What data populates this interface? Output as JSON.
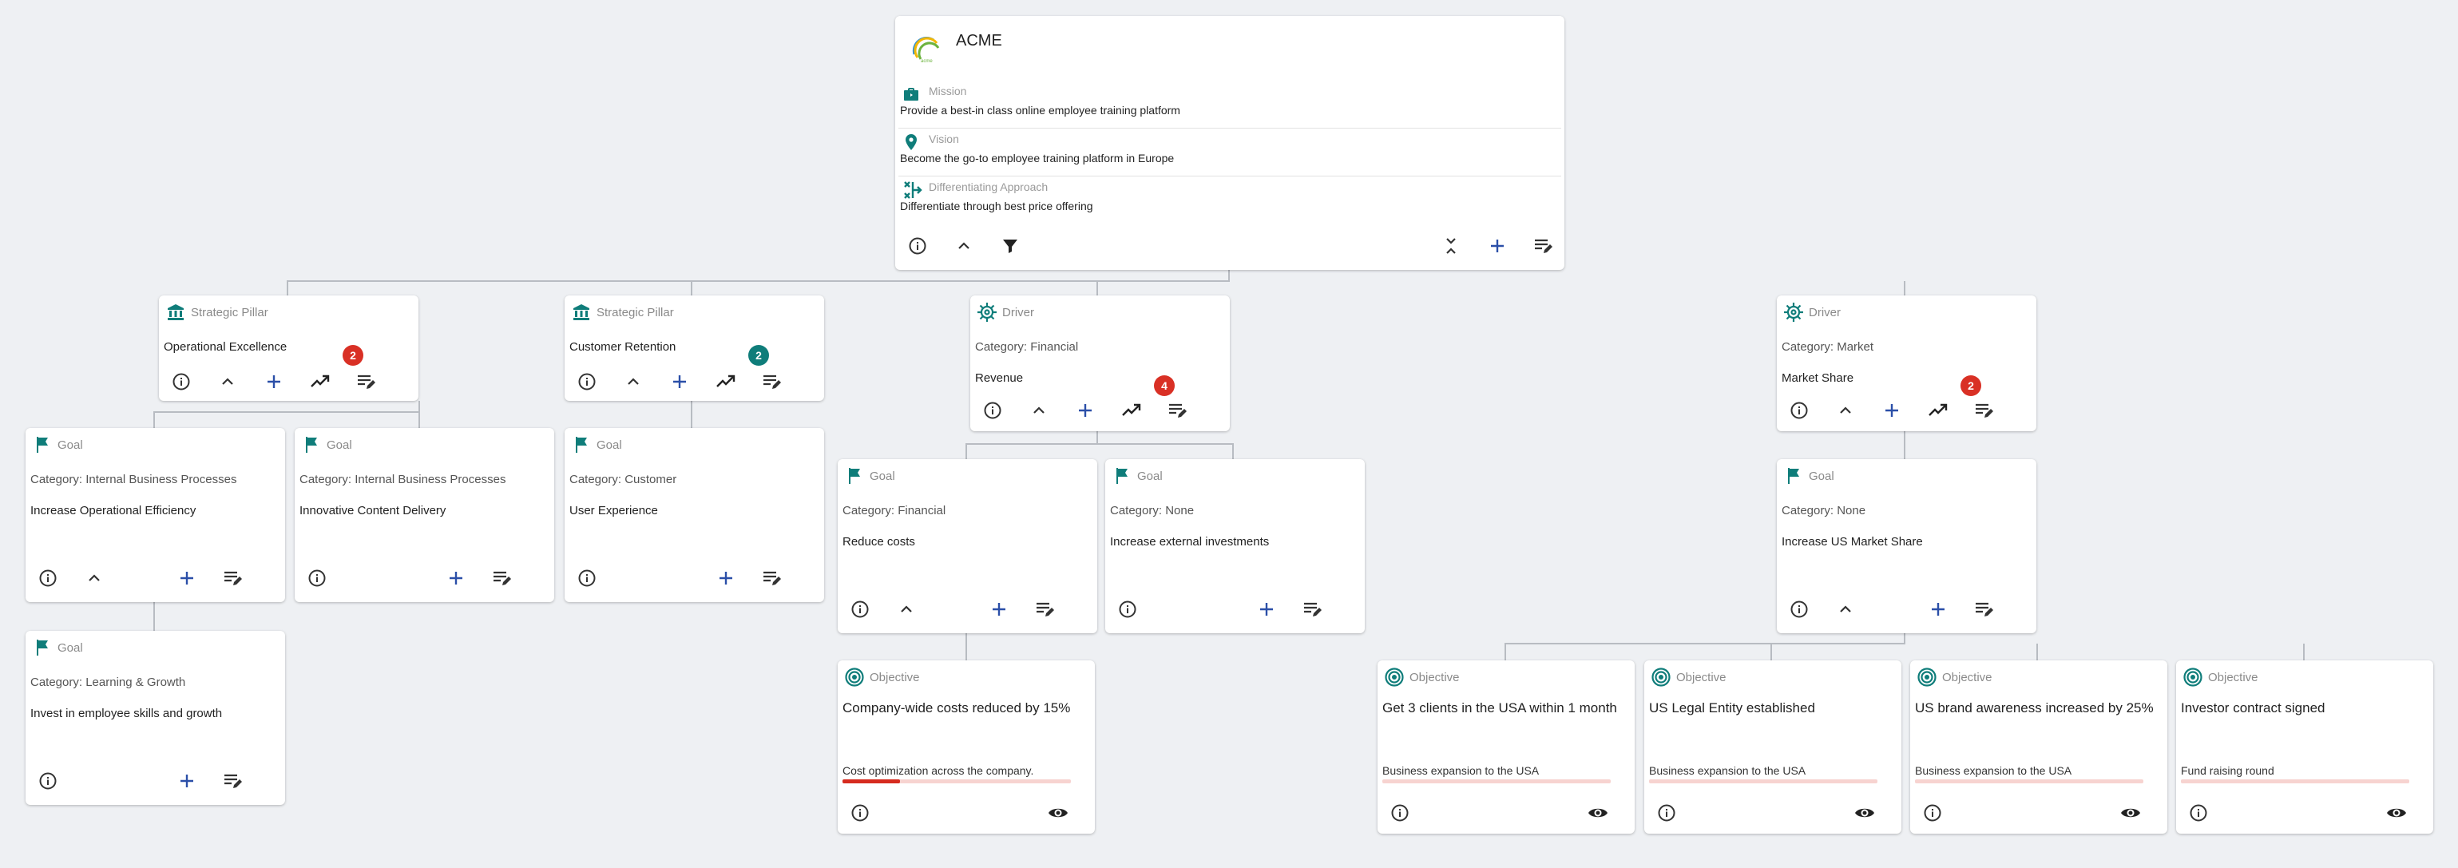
{
  "colors": {
    "teal": "#0f7d7a",
    "badge_red": "#d93025",
    "plus_blue": "#2b4fa8",
    "progress_red": "#d62b1f",
    "line": "#b8bcc2"
  },
  "root": {
    "title": "ACME",
    "mission_label": "Mission",
    "mission_text": "Provide a best-in class online employee training platform",
    "vision_label": "Vision",
    "vision_text": "Become the go-to employee training platform in Europe",
    "approach_label": "Differentiating Approach",
    "approach_text": "Differentiate through best price offering"
  },
  "pillars": [
    {
      "type": "Strategic Pillar",
      "name": "Operational Excellence",
      "badge": "2"
    },
    {
      "type": "Strategic Pillar",
      "name": "Customer Retention",
      "badge": "2"
    }
  ],
  "drivers": [
    {
      "type": "Driver",
      "category": "Category: Financial",
      "name": "Revenue",
      "badge": "4"
    },
    {
      "type": "Driver",
      "category": "Category: Market",
      "name": "Market Share",
      "badge": "2"
    }
  ],
  "goals": [
    {
      "type": "Goal",
      "category": "Category: Internal Business Processes",
      "name": "Increase Operational Efficiency"
    },
    {
      "type": "Goal",
      "category": "Category: Internal Business Processes",
      "name": "Innovative Content Delivery"
    },
    {
      "type": "Goal",
      "category": "Category: Customer",
      "name": "User Experience"
    },
    {
      "type": "Goal",
      "category": "Category: Learning & Growth",
      "name": "Invest in employee skills and growth"
    },
    {
      "type": "Goal",
      "category": "Category: Financial",
      "name": "Reduce costs"
    },
    {
      "type": "Goal",
      "category": "Category: None",
      "name": "Increase external investments"
    },
    {
      "type": "Goal",
      "category": "Category: None",
      "name": "Increase US Market Share"
    }
  ],
  "objectives": [
    {
      "type": "Objective",
      "name": "Company-wide costs reduced by 15%",
      "sub": "Cost optimization across the company.",
      "progress": 0.25
    },
    {
      "type": "Objective",
      "name": "Get 3 clients in the USA within 1 month",
      "sub": "Business expansion to the USA",
      "progress": 0
    },
    {
      "type": "Objective",
      "name": "US Legal Entity established",
      "sub": "Business expansion to the USA",
      "progress": 0
    },
    {
      "type": "Objective",
      "name": "US brand awareness increased by 25%",
      "sub": "Business expansion to the USA",
      "progress": 0
    },
    {
      "type": "Objective",
      "name": "Investor contract signed",
      "sub": "Fund raising round",
      "progress": 0
    }
  ],
  "icons": {
    "info": "info-icon",
    "collapse": "chevron-up-icon",
    "add": "plus-icon",
    "kpi": "trending-up-icon",
    "edit": "edit-list-icon",
    "view": "eye-icon",
    "filter": "filter-icon",
    "collapse_all": "collapse-all-icon",
    "goal": "flag-icon",
    "pillar": "bank-icon",
    "driver": "ship-wheel-icon",
    "objective": "target-icon"
  }
}
